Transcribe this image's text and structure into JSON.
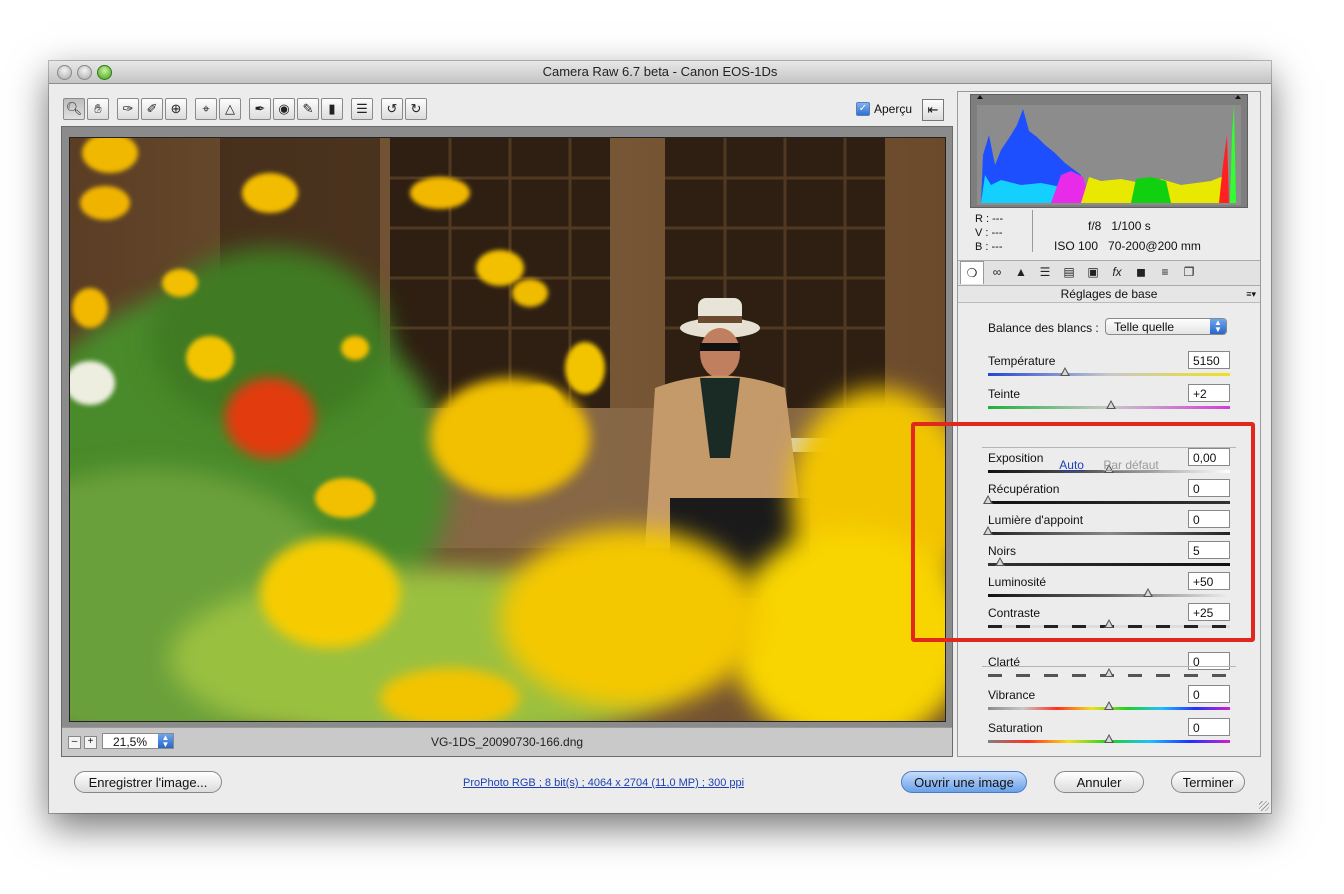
{
  "window": {
    "title": "Camera Raw 6.7 beta  -  Canon EOS-1Ds"
  },
  "toolbar": {
    "tools": [
      "zoom-icon",
      "hand-icon",
      "white-balance-icon",
      "color-sampler-icon",
      "target-adjust-icon",
      "crop-icon",
      "straighten-icon",
      "spot-removal-icon",
      "red-eye-icon",
      "adjustment-brush-icon",
      "graduated-filter-icon",
      "preferences-icon",
      "rotate-ccw-icon",
      "rotate-cw-icon"
    ],
    "preview_label": "Aperçu",
    "preview_checked": true
  },
  "image": {
    "zoom": "21,5%",
    "filename": "VG-1DS_20090730-166.dng"
  },
  "histogram": {
    "rgb_r": "R :  ---",
    "rgb_v": "V :  ---",
    "rgb_b": "B :  ---",
    "aperture_shutter": "f/8   1/100 s",
    "iso_lens": "ISO 100   70-200@200 mm"
  },
  "panel": {
    "tabs": [
      "basic-icon",
      "tone-curve-icon",
      "detail-icon",
      "hsl-icon",
      "split-toning-icon",
      "lens-icon",
      "fx-icon",
      "camera-calibration-icon",
      "presets-icon",
      "snapshots-icon"
    ],
    "section_title": "Réglages de base",
    "white_balance_label": "Balance des blancs :",
    "white_balance_value": "Telle quelle",
    "auto_label": "Auto",
    "default_label": "Par défaut",
    "sliders": [
      {
        "label": "Température",
        "value": "5150",
        "position": 0.32
      },
      {
        "label": "Teinte",
        "value": "+2",
        "position": 0.51
      },
      {
        "label": "Exposition",
        "value": "0,00",
        "position": 0.5
      },
      {
        "label": "Récupération",
        "value": "0",
        "position": 0.0
      },
      {
        "label": "Lumière d'appoint",
        "value": "0",
        "position": 0.0
      },
      {
        "label": "Noirs",
        "value": "5",
        "position": 0.05
      },
      {
        "label": "Luminosité",
        "value": "+50",
        "position": 0.66
      },
      {
        "label": "Contraste",
        "value": "+25",
        "position": 0.5
      },
      {
        "label": "Clarté",
        "value": "0",
        "position": 0.5
      },
      {
        "label": "Vibrance",
        "value": "0",
        "position": 0.5
      },
      {
        "label": "Saturation",
        "value": "0",
        "position": 0.5
      }
    ]
  },
  "footer": {
    "save_label": "Enregistrer l'image...",
    "info_link": "ProPhoto RGB ; 8 bit(s) ; 4064 x 2704 (11,0 MP) ; 300 ppi",
    "open_label": "Ouvrir une image",
    "cancel_label": "Annuler",
    "done_label": "Terminer"
  },
  "colors": {
    "highlight": "#e0281c",
    "accent": "#2a66c8",
    "link": "#1c3fb5"
  }
}
